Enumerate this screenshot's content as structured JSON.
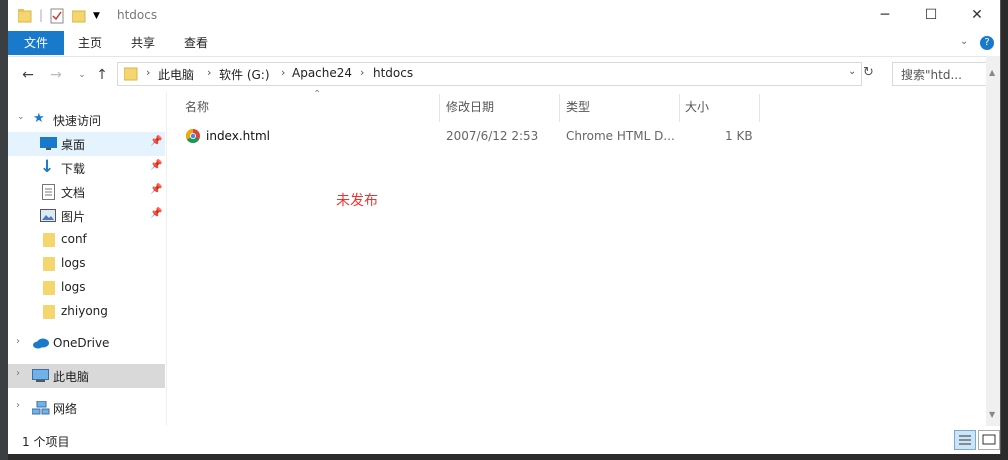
{
  "window": {
    "title": "htdocs",
    "controls": {
      "minimize": "─",
      "maximize": "☐",
      "close": "✕"
    }
  },
  "ribbon": {
    "tabs": [
      "文件",
      "主页",
      "共享",
      "查看"
    ],
    "help": "?"
  },
  "address_bar": {
    "crumbs": [
      "此电脑",
      "软件 (G:)",
      "Apache24",
      "htdocs"
    ],
    "search_placeholder": "搜索\"htd..."
  },
  "nav_pane": {
    "quick_access": "快速访问",
    "quick_items": [
      "桌面",
      "下载",
      "文档",
      "图片"
    ],
    "folders": [
      "conf",
      "logs",
      "logs",
      "zhiyong"
    ],
    "onedrive": "OneDrive",
    "this_pc": "此电脑",
    "network": "网络"
  },
  "columns": [
    "名称",
    "修改日期",
    "类型",
    "大小"
  ],
  "files": [
    {
      "name": "index.html",
      "modified": "2007/6/12 2:53",
      "type": "Chrome HTML D...",
      "size": "1 KB"
    }
  ],
  "annotation": "未发布",
  "status": {
    "item_count": "1 个项目"
  },
  "colors": {
    "accent": "#1979ca",
    "annotation": "#e33333",
    "selection": "#e5f3ff"
  }
}
